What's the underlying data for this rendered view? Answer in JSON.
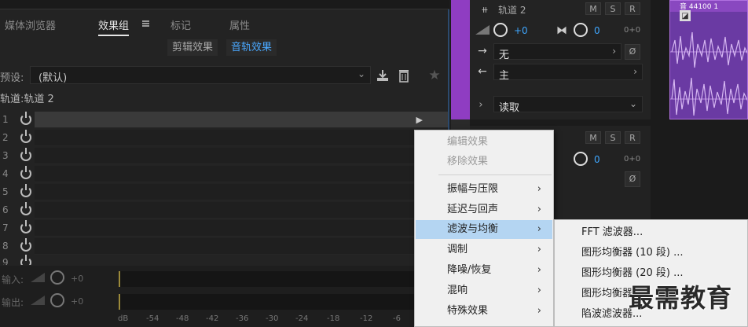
{
  "panel_tabs": [
    "媒体浏览器",
    "效果组",
    "标记",
    "属性"
  ],
  "active_tab": "效果组",
  "segments": [
    "剪辑效果",
    "音轨效果"
  ],
  "preset": {
    "label": "预设:",
    "value": "(默认)"
  },
  "track_title": "轨道:轨道 2",
  "rack_rows": [
    "1",
    "2",
    "3",
    "4",
    "5",
    "6",
    "7",
    "8",
    "9"
  ],
  "io": {
    "input_label": "输入:",
    "input_value": "+0",
    "output_label": "输出:",
    "output_value": "+0"
  },
  "db_scale": [
    "dB",
    "-54",
    "-48",
    "-42",
    "-36",
    "-30",
    "-24",
    "-18",
    "-12",
    "-6"
  ],
  "tracks": [
    {
      "name": "轨道 2",
      "m": "M",
      "s": "S",
      "r": "R",
      "volume": "+0",
      "pan": "0",
      "input": "无",
      "output": "主",
      "automation": "读取",
      "pan_label": "0+0"
    },
    {
      "m": "M",
      "s": "S",
      "r": "R",
      "pan": "0",
      "pan_label": "0+0"
    }
  ],
  "clip_label": "音 44100 1",
  "context_menu": {
    "items": [
      {
        "label": "编辑效果",
        "disabled": true
      },
      {
        "label": "移除效果",
        "disabled": true
      },
      {
        "label": "振幅与压限",
        "submenu": true
      },
      {
        "label": "延迟与回声",
        "submenu": true
      },
      {
        "label": "滤波与均衡",
        "submenu": true,
        "highlighted": true
      },
      {
        "label": "调制",
        "submenu": true
      },
      {
        "label": "降噪/恢复",
        "submenu": true
      },
      {
        "label": "混响",
        "submenu": true
      },
      {
        "label": "特殊效果",
        "submenu": true
      }
    ],
    "submenu_arrow": "›"
  },
  "submenu": [
    "FFT 滤波器...",
    "图形均衡器 (10 段) ...",
    "图形均衡器 (20 段) ...",
    "图形均衡器",
    "陷波滤波器..."
  ],
  "watermark": "最需教育",
  "colors": {
    "accent_blue": "#3fa7ff",
    "track_purple": "#8f3dc2",
    "menu_highlight": "#b4d5f2"
  }
}
